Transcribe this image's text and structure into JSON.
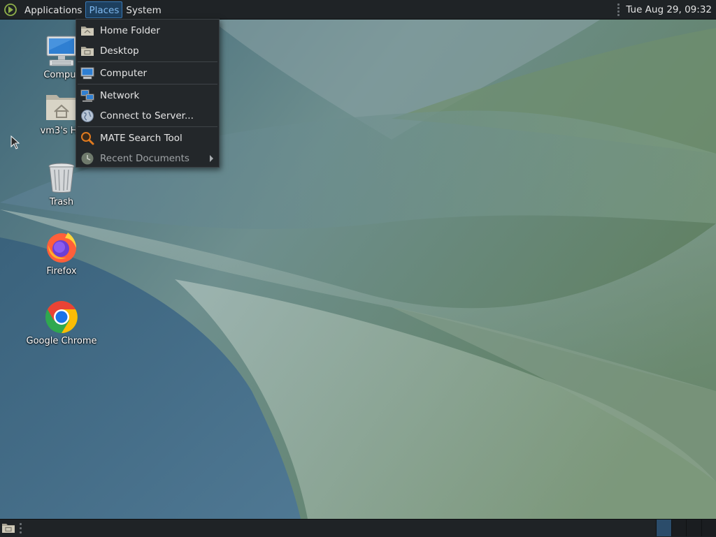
{
  "top_panel": {
    "menus": [
      {
        "label": "Applications"
      },
      {
        "label": "Places"
      },
      {
        "label": "System"
      }
    ],
    "clock": "Tue Aug 29, 09:32"
  },
  "desktop_icons": [
    {
      "label": "Comput",
      "icon": "computer-icon"
    },
    {
      "label": "vm3's Ho",
      "icon": "home-folder-icon"
    },
    {
      "label": "Trash",
      "icon": "trash-icon"
    },
    {
      "label": "Firefox",
      "icon": "firefox-icon"
    },
    {
      "label": "Google Chrome",
      "icon": "chrome-icon"
    }
  ],
  "places_menu": {
    "items": [
      {
        "label": "Home Folder",
        "icon": "home-folder-icon"
      },
      {
        "label": "Desktop",
        "icon": "desktop-folder-icon"
      },
      {
        "label": "Computer",
        "icon": "computer-icon"
      },
      {
        "label": "Network",
        "icon": "network-icon"
      },
      {
        "label": "Connect to Server...",
        "icon": "globe-icon"
      },
      {
        "label": "MATE Search Tool",
        "icon": "search-icon"
      },
      {
        "label": "Recent Documents",
        "icon": "recent-documents-icon"
      }
    ]
  },
  "colors": {
    "panel_bg": "#1f2326",
    "menu_bg": "#23272a",
    "active_menu_bg": "#1d3f5e",
    "active_menu_text": "#7fb8ee"
  }
}
